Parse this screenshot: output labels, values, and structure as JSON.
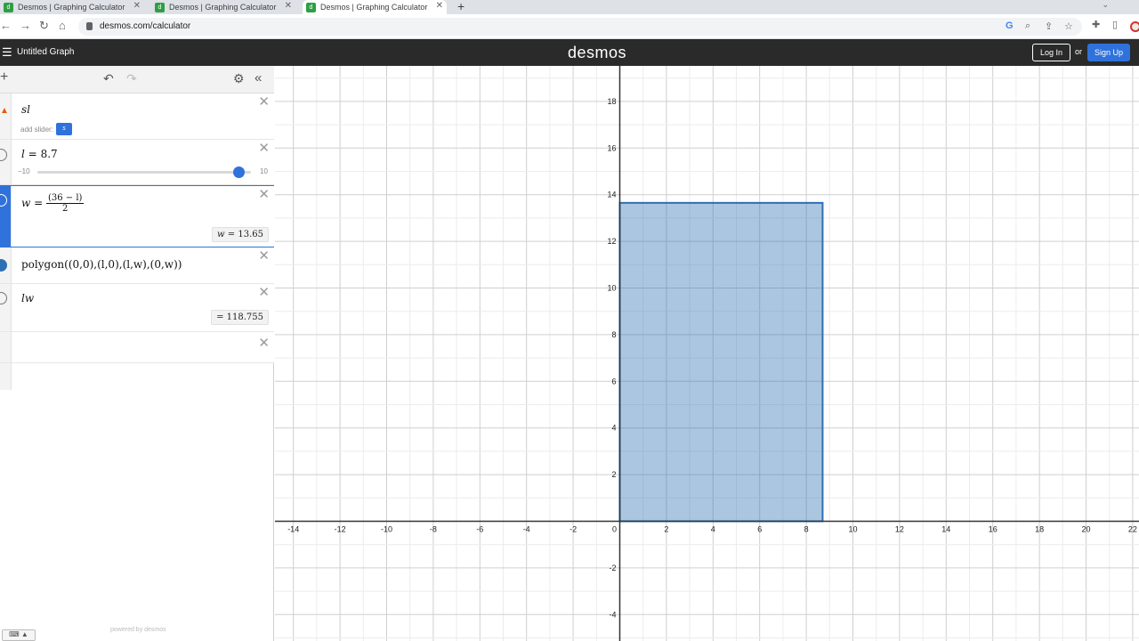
{
  "browser": {
    "tabs": [
      {
        "title": "Desmos | Graphing Calculator",
        "favicon": "desmos-favicon",
        "active": false
      },
      {
        "title": "Desmos | Graphing Calculator",
        "favicon": "desmos-favicon",
        "active": false
      },
      {
        "title": "Desmos | Graphing Calculator",
        "favicon": "desmos-favicon",
        "active": true
      }
    ],
    "url": "desmos.com/calculator"
  },
  "header": {
    "graph_title": "Untitled Graph",
    "logo": "desmos",
    "login": "Log In",
    "or": "or",
    "signup": "Sign Up"
  },
  "expressions": {
    "e1": {
      "text": "sl",
      "add_slider_label": "add slider:",
      "slider_chip": "s"
    },
    "e2": {
      "lhs": "l",
      "eq": "=",
      "value": "8.7",
      "slider_min": "−10",
      "slider_max": "10"
    },
    "e3": {
      "lhs": "w",
      "eq": "=",
      "numerator": "(36 − l)",
      "denominator": "2",
      "result_var": "w",
      "result": "13.65"
    },
    "e4": {
      "text": "polygon((0,0),(l,0),(l,w),(0,w))"
    },
    "e5": {
      "text": "lw",
      "result": "118.755"
    }
  },
  "powered_by": "powered by desmos",
  "graph": {
    "x_ticks": [
      "-14",
      "-12",
      "-10",
      "-8",
      "-6",
      "-4",
      "-2",
      "0",
      "2",
      "4",
      "6",
      "8",
      "10",
      "12",
      "14",
      "16",
      "18",
      "20",
      "22"
    ],
    "y_ticks": [
      "18",
      "16",
      "14",
      "12",
      "10",
      "8",
      "6",
      "4",
      "2",
      "-2",
      "-4"
    ],
    "rect_l": 8.7,
    "rect_w": 13.65,
    "fill_color": "#2d70b3"
  }
}
